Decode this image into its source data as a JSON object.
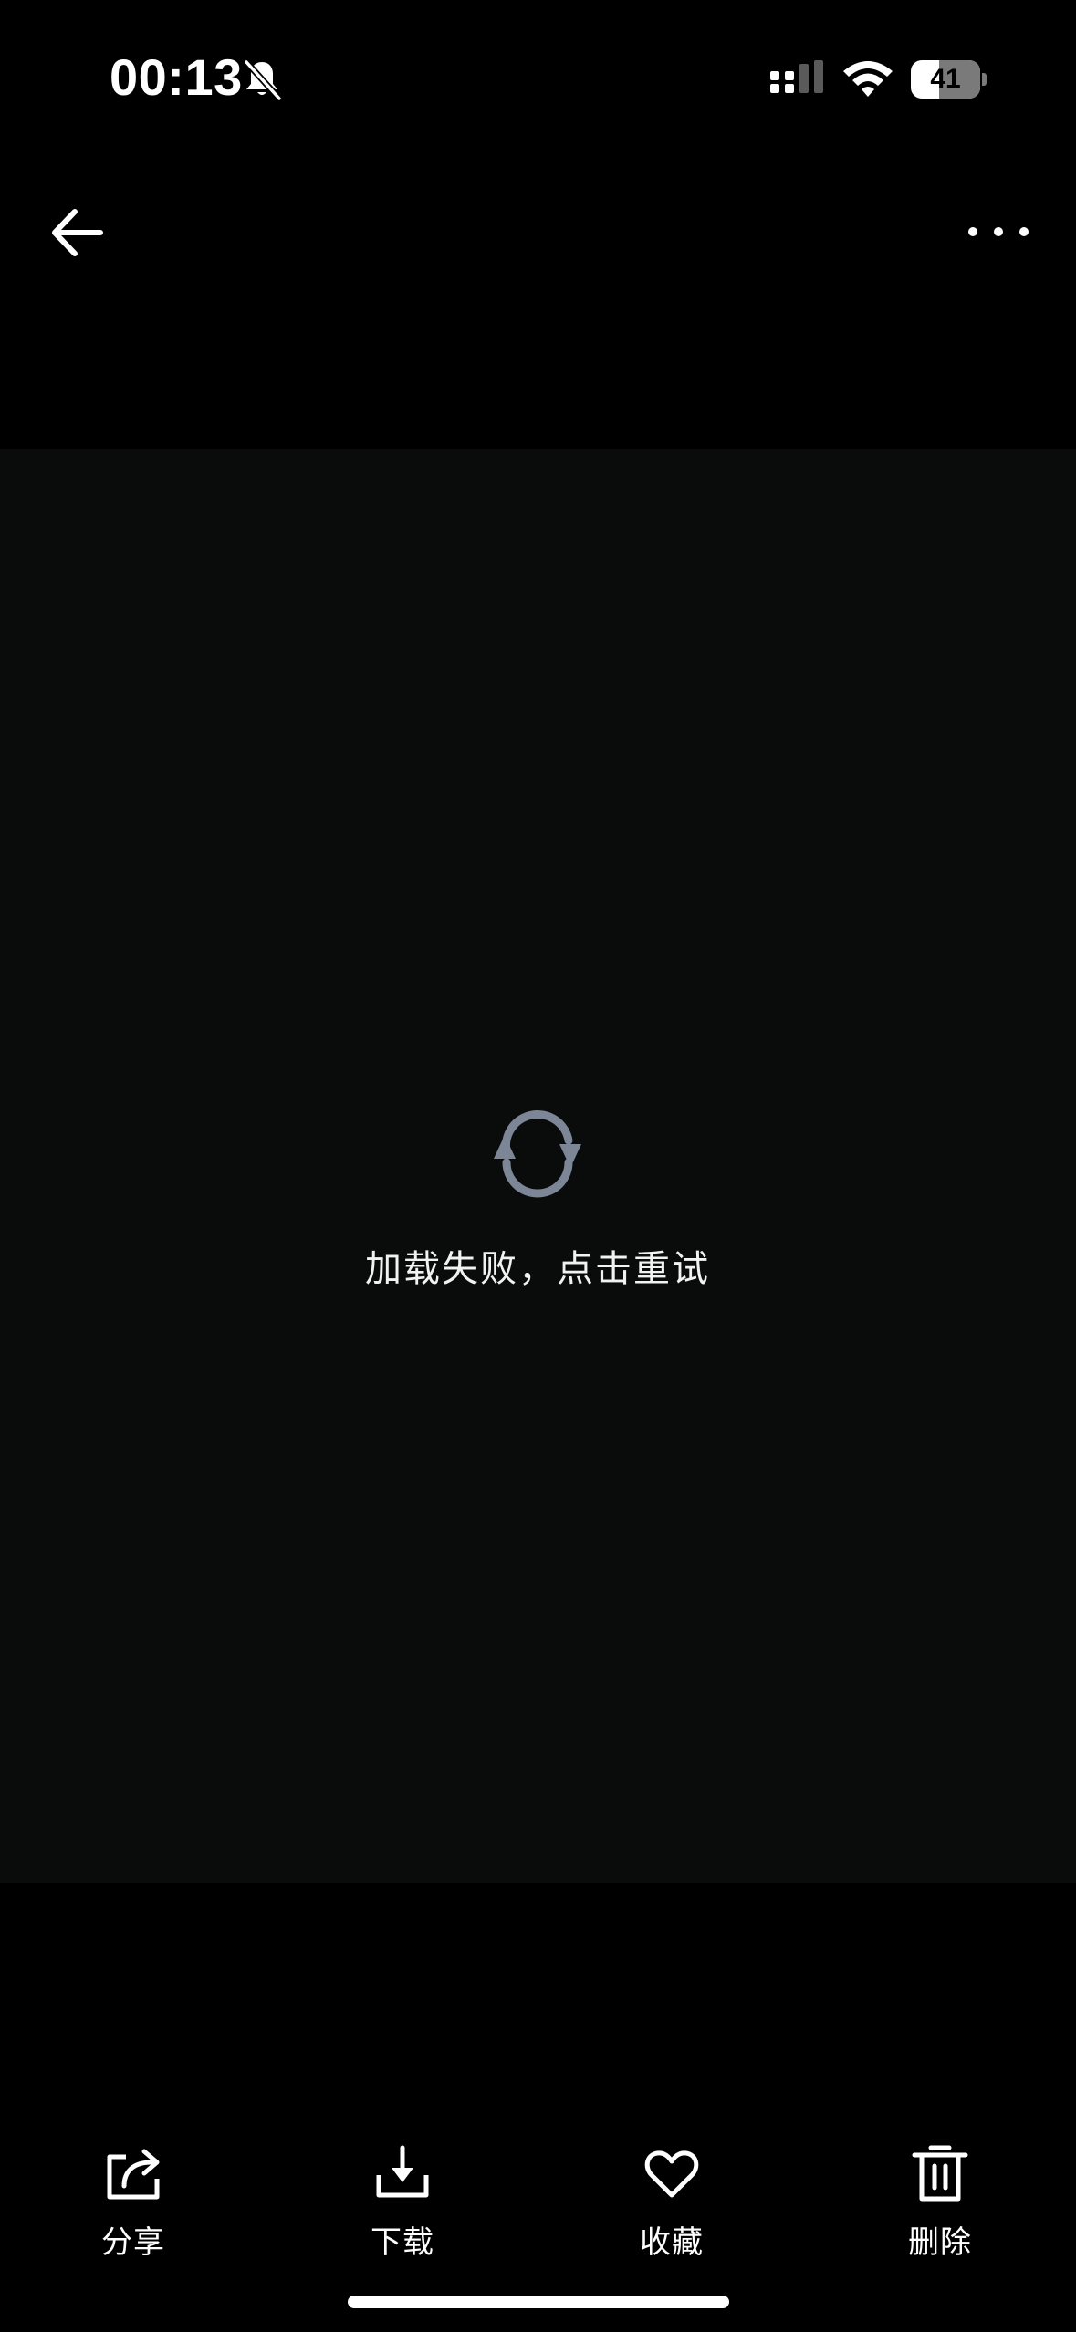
{
  "status_bar": {
    "time": "00:13",
    "battery_percent": "41",
    "battery_level": 0.41
  },
  "content": {
    "retry_message": "加载失败，点击重试"
  },
  "toolbar": {
    "share_label": "分享",
    "download_label": "下载",
    "favorite_label": "收藏",
    "delete_label": "删除"
  },
  "colors": {
    "page_background": "#000000",
    "content_background": "#0a0c0c",
    "refresh_icon": "#7c8696",
    "text": "#ffffff"
  },
  "icons": {
    "back": "arrow-left-icon",
    "more": "more-dots-icon",
    "refresh": "refresh-icon",
    "share": "share-icon",
    "download": "download-icon",
    "favorite": "heart-icon",
    "delete": "trash-icon"
  }
}
